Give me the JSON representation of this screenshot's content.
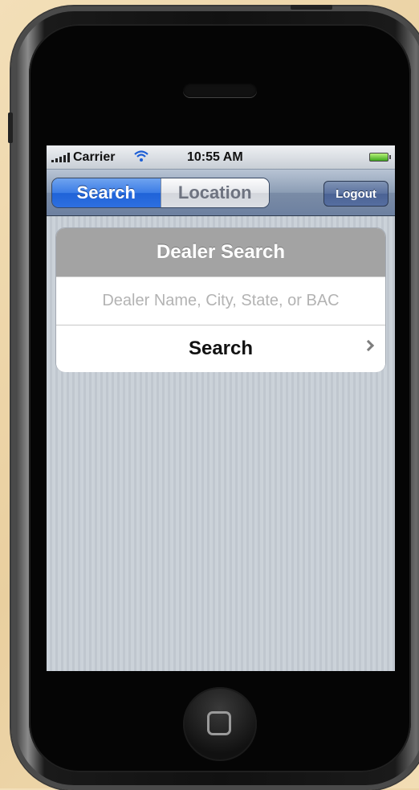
{
  "status_bar": {
    "carrier": "Carrier",
    "time": "10:55 AM",
    "icons": [
      "signal-icon",
      "wifi-icon",
      "battery-icon"
    ]
  },
  "navbar": {
    "tabs": [
      {
        "label": "Search",
        "active": true
      },
      {
        "label": "Location",
        "active": false
      }
    ],
    "logout_label": "Logout"
  },
  "dealer_search": {
    "title": "Dealer Search",
    "input": {
      "value": "",
      "placeholder": "Dealer Name, City, State, or BAC"
    },
    "search_label": "Search"
  },
  "colors": {
    "active_tab": "#2e6fe0",
    "navbar": "#7a8ca6",
    "screen_bg": "#c5ccd4",
    "card_header": "#a3a3a3"
  }
}
